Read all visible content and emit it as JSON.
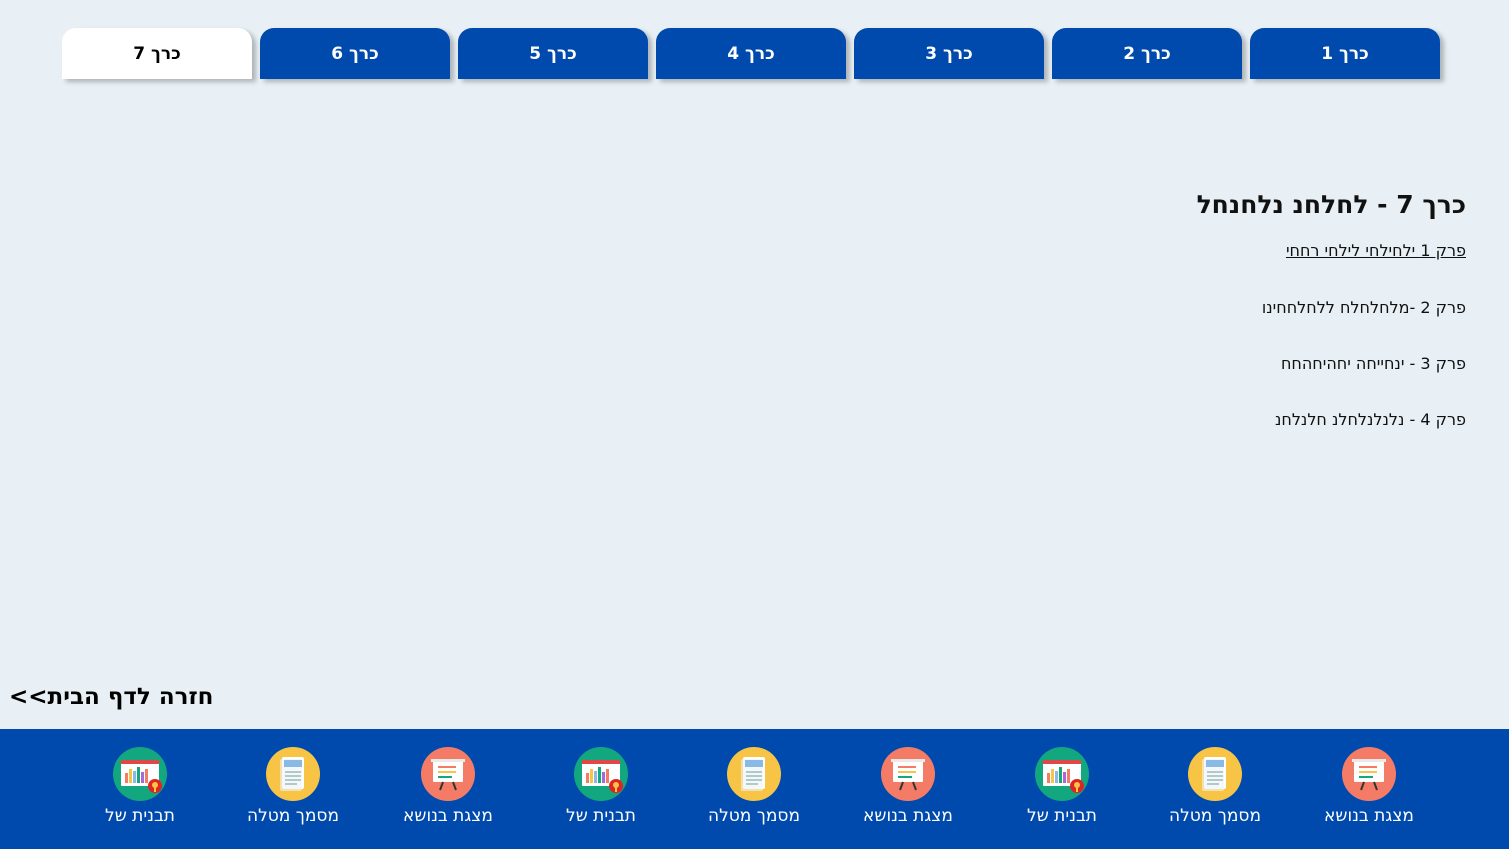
{
  "tabs": [
    {
      "label": "כרך 1",
      "active": false
    },
    {
      "label": "כרך 2",
      "active": false
    },
    {
      "label": "כרך 3",
      "active": false
    },
    {
      "label": "כרך 4",
      "active": false
    },
    {
      "label": "כרך 5",
      "active": false
    },
    {
      "label": "כרך 6",
      "active": false
    },
    {
      "label": "כרך 7",
      "active": true
    }
  ],
  "content": {
    "title": "כרך 7 - לחלחנ נלחנחל",
    "chapters": [
      "פרק 1 ילחילחי לילחי רחחי",
      "פרק 2 -מלחלחלח ללחלחחינו",
      "פרק 3 - ינחייחה יחהיחהחח",
      "פרק 4 - נלנלנלחלנ חלנלחנ"
    ]
  },
  "back_link": "חזרה לדף הבית>>",
  "footer": {
    "items": [
      {
        "label": "מצגת בנושא",
        "icon": "presentation-icon"
      },
      {
        "label": "מסמך מטלה",
        "icon": "document-icon"
      },
      {
        "label": "תבנית של",
        "icon": "chart-template-icon"
      },
      {
        "label": "מצגת בנושא",
        "icon": "presentation-icon"
      },
      {
        "label": "מסמך מטלה",
        "icon": "document-icon"
      },
      {
        "label": "תבנית של",
        "icon": "chart-template-icon"
      },
      {
        "label": "מצגת בנושא",
        "icon": "presentation-icon"
      },
      {
        "label": "מסמך מטלה",
        "icon": "document-icon"
      },
      {
        "label": "תבנית של",
        "icon": "chart-template-icon"
      }
    ]
  },
  "colors": {
    "primary": "#004aad",
    "background": "#e8f0f5",
    "presentation_icon_bg": "#f47c67",
    "document_icon_bg": "#f8c446",
    "chart_icon_bg": "#13a77f"
  }
}
